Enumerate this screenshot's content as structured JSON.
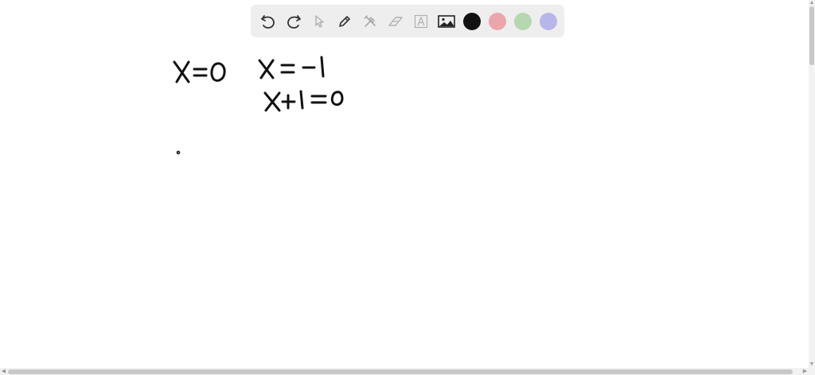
{
  "toolbar": {
    "tools": [
      {
        "name": "undo-icon"
      },
      {
        "name": "redo-icon"
      },
      {
        "name": "pointer-icon"
      },
      {
        "name": "pen-icon"
      },
      {
        "name": "tools-icon"
      },
      {
        "name": "eraser-icon"
      },
      {
        "name": "text-icon"
      },
      {
        "name": "image-icon"
      }
    ],
    "colors": [
      {
        "name": "color-black",
        "hex": "#111111"
      },
      {
        "name": "color-red",
        "hex": "#eba5ab"
      },
      {
        "name": "color-green",
        "hex": "#b6d8b0"
      },
      {
        "name": "color-blue",
        "hex": "#b8b5ea"
      }
    ]
  },
  "whiteboard": {
    "handwriting": [
      "x=0",
      "x=-1",
      "x+1=0"
    ]
  }
}
